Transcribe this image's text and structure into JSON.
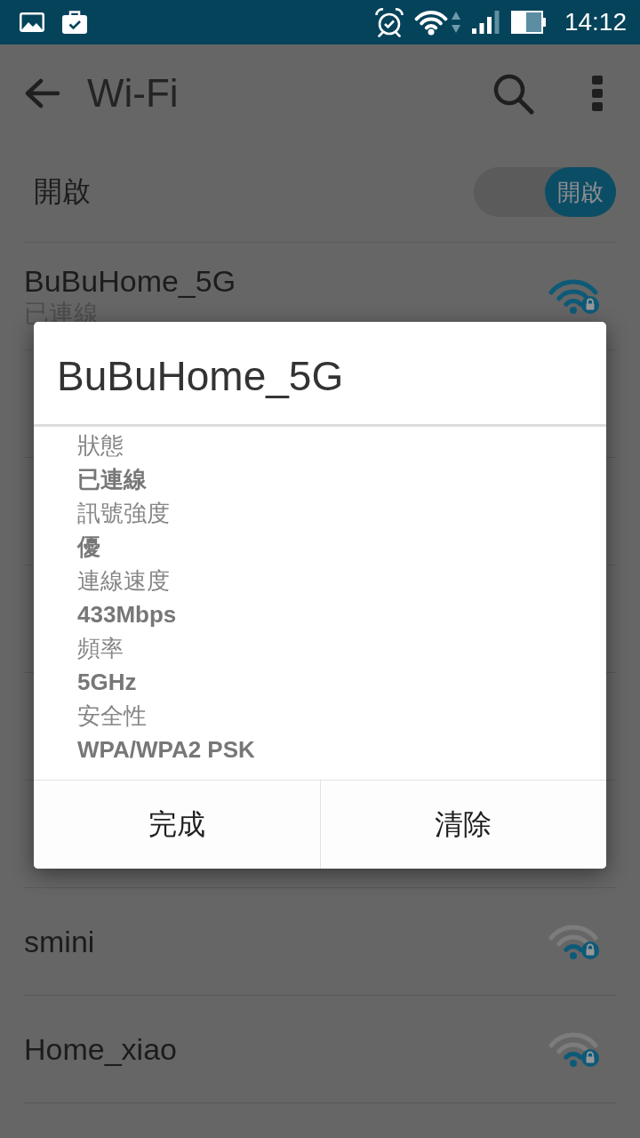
{
  "status_bar": {
    "time": "14:12"
  },
  "app_bar": {
    "title": "Wi-Fi"
  },
  "wifi_switch": {
    "label": "開啟",
    "on": true,
    "thumb_label": "開啟"
  },
  "networks_above_dialog": [
    {
      "name": "BuBuHome_5G",
      "status": "已連線",
      "full_signal": true,
      "secured": true
    }
  ],
  "networks_below_dialog": [
    {
      "name": "smini",
      "full_signal": false,
      "secured": true
    },
    {
      "name": "Home_xiao",
      "full_signal": false,
      "secured": true
    }
  ],
  "dialog": {
    "title": "BuBuHome_5G",
    "details": [
      {
        "label": "狀態",
        "value": "已連線"
      },
      {
        "label": "訊號強度",
        "value": "優"
      },
      {
        "label": "連線速度",
        "value": "433Mbps"
      },
      {
        "label": "頻率",
        "value": "5GHz"
      },
      {
        "label": "安全性",
        "value": "WPA/WPA2 PSK"
      }
    ],
    "buttons": [
      "完成",
      "清除"
    ]
  }
}
